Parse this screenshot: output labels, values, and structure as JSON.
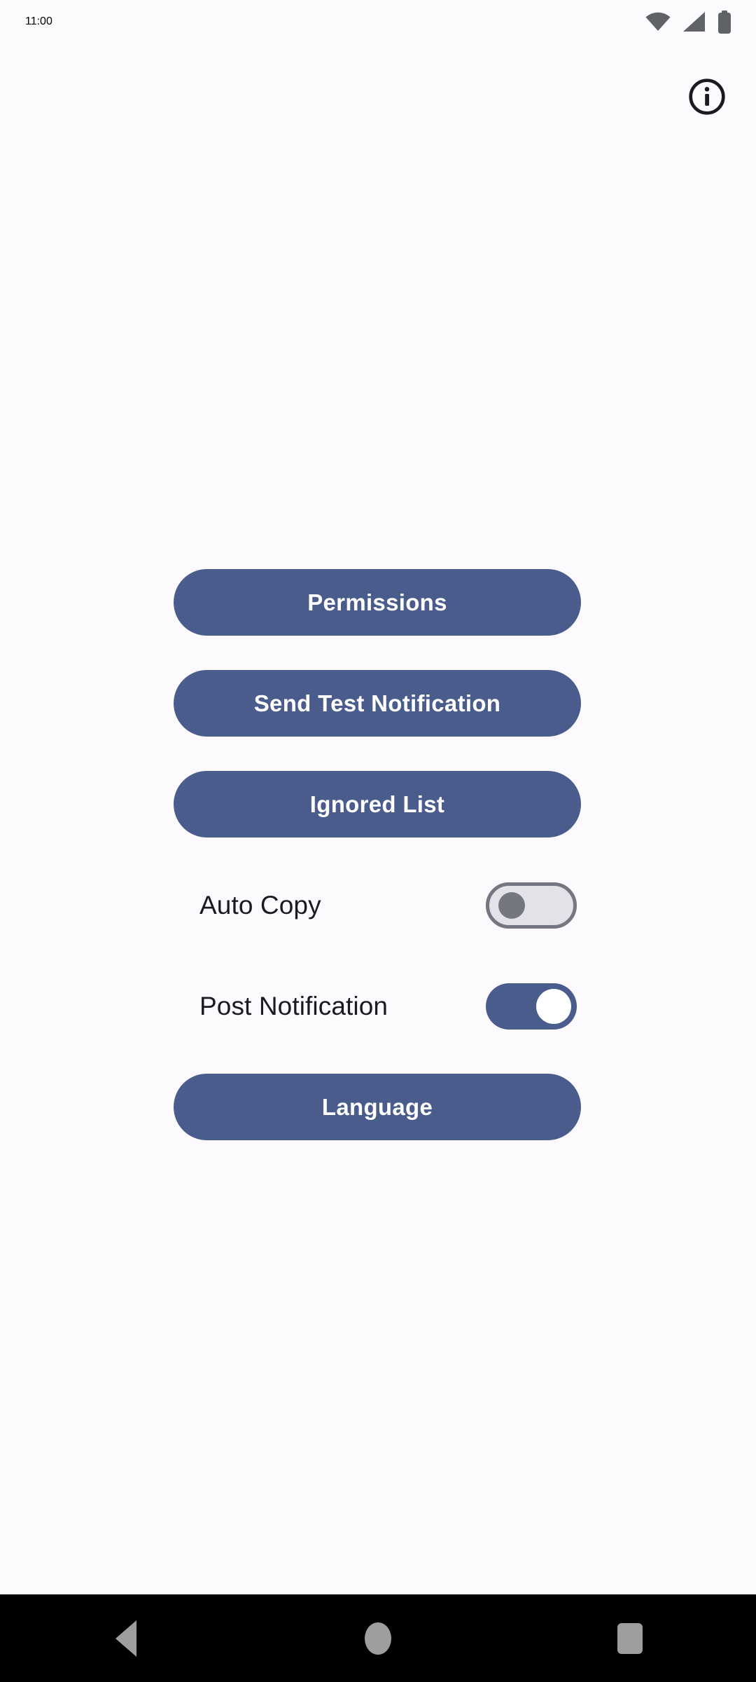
{
  "status_bar": {
    "time": "11:00",
    "icons": [
      "wifi-icon",
      "cellular-signal-icon",
      "battery-icon"
    ],
    "text_color": "#5A5C61"
  },
  "header": {
    "info_icon": "info-icon"
  },
  "theme": {
    "background": "#FCFAFD",
    "accent": "#4A5C8C",
    "button_text": "#FFFFFF",
    "label_text": "#1B1B1F",
    "toggle_off_track": "#E3E2E9",
    "toggle_off_border": "#74777F",
    "toggle_off_knob": "#74777F",
    "toggle_on_track": "#4A5C8C",
    "toggle_on_knob": "#FFFFFF",
    "nav_bar_background": "#000000",
    "nav_icon_color": "#9E9E9E"
  },
  "main": {
    "buttons": [
      {
        "label": "Permissions"
      },
      {
        "label": "Send Test Notification"
      },
      {
        "label": "Ignored List"
      }
    ],
    "switches": [
      {
        "label": "Auto Copy",
        "state": "off"
      },
      {
        "label": "Post Notification",
        "state": "on"
      }
    ],
    "language_button": {
      "label": "Language"
    }
  },
  "navigation_bar": {
    "items": [
      {
        "name": "back-icon"
      },
      {
        "name": "home-icon"
      },
      {
        "name": "recents-icon"
      }
    ]
  }
}
